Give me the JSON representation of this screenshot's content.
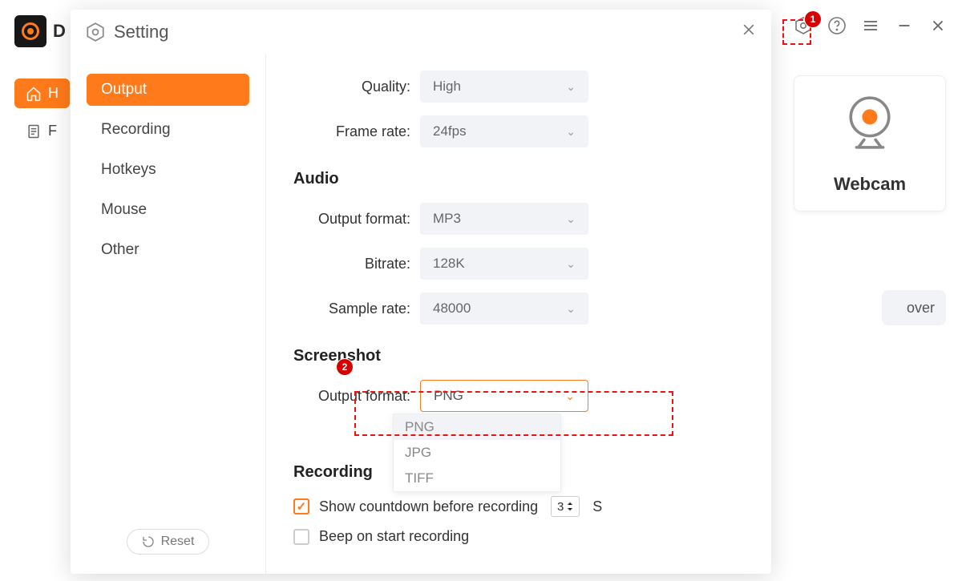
{
  "app": {
    "initial": "D"
  },
  "background": {
    "left_tabs": [
      {
        "label": "H",
        "active": true
      },
      {
        "label": "F",
        "active": false
      }
    ],
    "webcam_label": "Webcam",
    "over_text": "over"
  },
  "modal": {
    "title": "Setting",
    "reset": "Reset",
    "sidebar": {
      "items": [
        {
          "label": "Output",
          "active": true
        },
        {
          "label": "Recording",
          "active": false
        },
        {
          "label": "Hotkeys",
          "active": false
        },
        {
          "label": "Mouse",
          "active": false
        },
        {
          "label": "Other",
          "active": false
        }
      ]
    },
    "settings": {
      "video": {
        "quality_label": "Quality:",
        "quality_value": "High",
        "framerate_label": "Frame rate:",
        "framerate_value": "24fps"
      },
      "audio": {
        "heading": "Audio",
        "format_label": "Output format:",
        "format_value": "MP3",
        "bitrate_label": "Bitrate:",
        "bitrate_value": "128K",
        "samplerate_label": "Sample rate:",
        "samplerate_value": "48000"
      },
      "screenshot": {
        "heading": "Screenshot",
        "format_label": "Output format:",
        "format_value": "PNG",
        "options": [
          "PNG",
          "JPG",
          "TIFF"
        ]
      },
      "recording": {
        "heading": "Recording",
        "countdown_label": "Show countdown before recording",
        "countdown_value": "3",
        "countdown_suffix": "S",
        "beep_label": "Beep on start recording"
      }
    }
  },
  "callouts": {
    "one": "1",
    "two": "2"
  }
}
